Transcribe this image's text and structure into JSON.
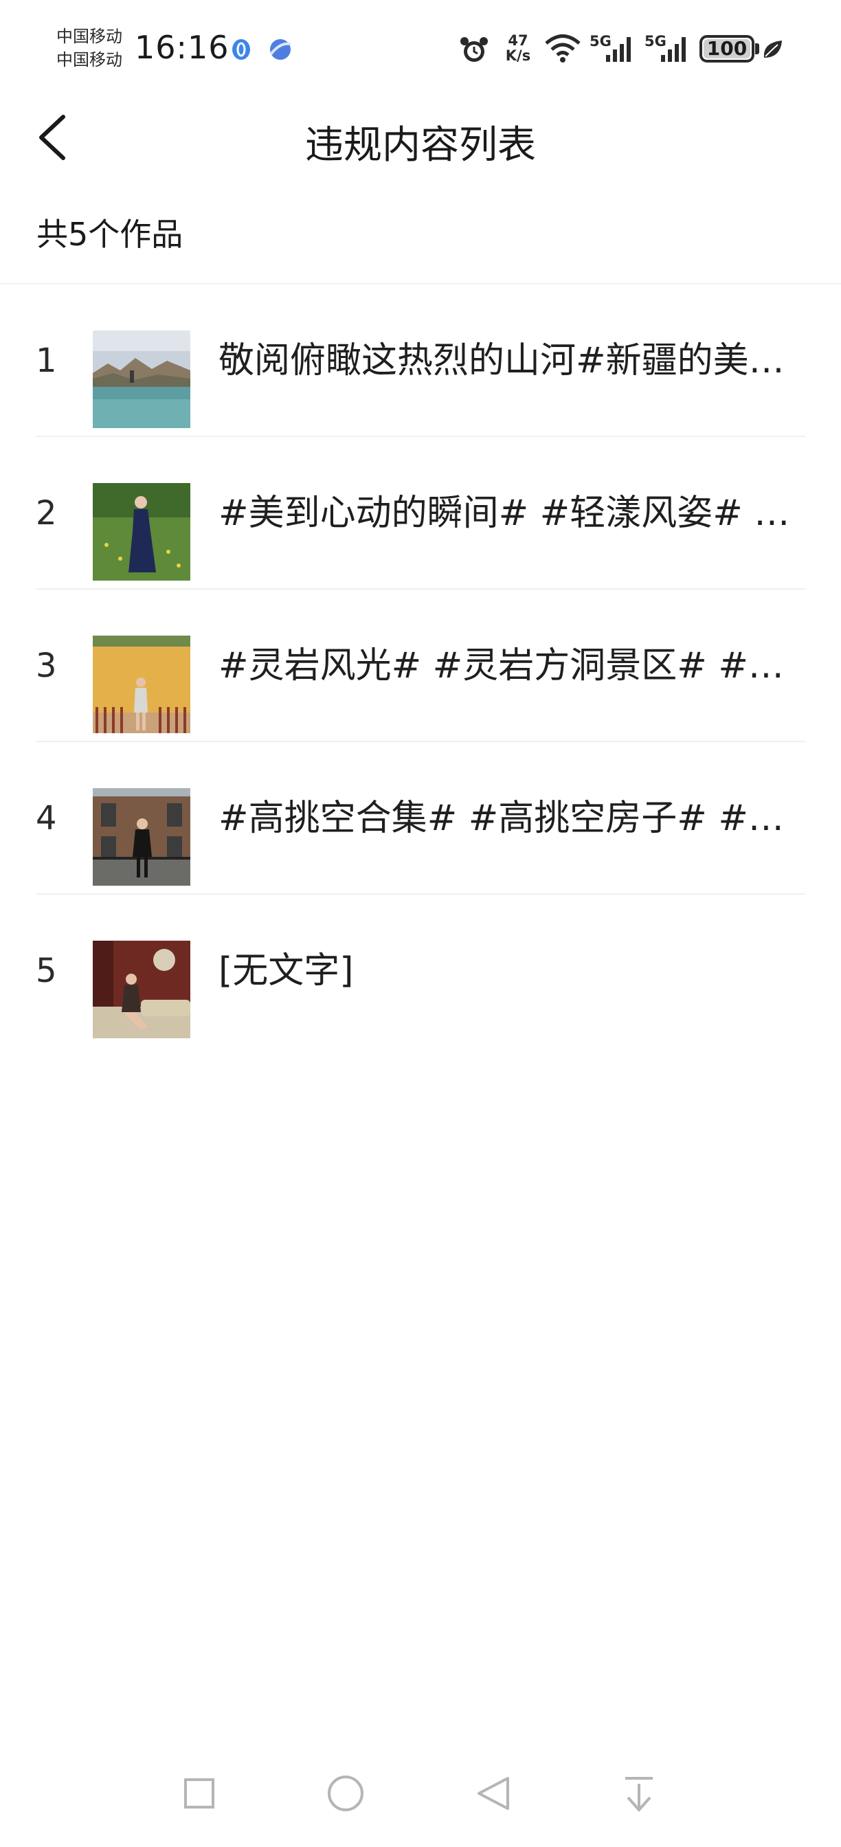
{
  "status_bar": {
    "carrier_1": "中国移动",
    "carrier_2": "中国移动",
    "time": "16:16",
    "speed_value": "47",
    "speed_unit": "K/s",
    "network_1": "5G",
    "network_2": "5G",
    "battery": "100",
    "icons": [
      "app-notification-icon",
      "browser-notification-icon",
      "alarm-icon",
      "wifi-icon",
      "signal-icon",
      "battery-icon",
      "eco-leaf-icon"
    ]
  },
  "header": {
    "title": "违规内容列表",
    "back_icon": "chevron-left-icon"
  },
  "summary": "共5个作品",
  "items": [
    {
      "index": "1",
      "text": "敬阅俯瞰这热烈的山河#新疆的美不…",
      "thumb": "lake-landscape"
    },
    {
      "index": "2",
      "text": "#美到心动的瞬间# #轻漾风姿# #…",
      "thumb": "woman-in-meadow"
    },
    {
      "index": "3",
      "text": "#灵岩风光# #灵岩方洞景区# #灵…",
      "thumb": "woman-by-yellow-wall"
    },
    {
      "index": "4",
      "text": "#高挑空合集# #高挑空房子# #空…",
      "thumb": "woman-by-brick-building"
    },
    {
      "index": "5",
      "text": "[无文字]",
      "thumb": "woman-in-interior"
    }
  ],
  "nav_bar": {
    "buttons": [
      "recents-square-icon",
      "home-circle-icon",
      "back-triangle-icon",
      "pull-down-icon"
    ]
  },
  "colors": {
    "text_primary": "#1f1f1f",
    "divider": "#f0f0f0",
    "background": "#ffffff",
    "nav_icon": "#b5b5b5"
  }
}
